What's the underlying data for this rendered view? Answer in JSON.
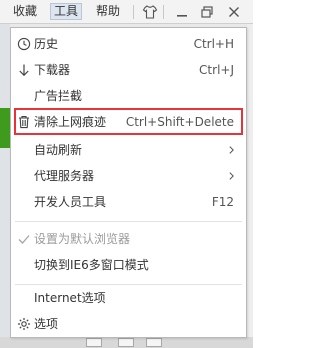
{
  "menubar": {
    "favorites_label": "收藏",
    "tools_label": "工具",
    "help_label": "帮助"
  },
  "menu": {
    "items": [
      {
        "label": "历史",
        "shortcut": "Ctrl+H",
        "icon": "clock-icon"
      },
      {
        "label": "下载器",
        "shortcut": "Ctrl+J",
        "icon": "download-arrow-icon"
      },
      {
        "label": "广告拦截",
        "shortcut": "",
        "icon": ""
      },
      {
        "label": "清除上网痕迹",
        "shortcut": "Ctrl+Shift+Delete",
        "icon": "trash-icon"
      },
      {
        "label": "自动刷新",
        "shortcut": "",
        "icon": "",
        "submenu": true
      },
      {
        "label": "代理服务器",
        "shortcut": "",
        "icon": "",
        "submenu": true
      },
      {
        "label": "开发人员工具",
        "shortcut": "F12",
        "icon": ""
      },
      {
        "label": "设置为默认浏览器",
        "shortcut": "",
        "icon": "check-icon",
        "disabled": true
      },
      {
        "label": "切换到IE6多窗口模式",
        "shortcut": "",
        "icon": ""
      },
      {
        "label": "Internet选项",
        "shortcut": "",
        "icon": ""
      },
      {
        "label": "选项",
        "shortcut": "",
        "icon": "gear-icon"
      }
    ]
  },
  "colors": {
    "highlight_border": "#e8333a",
    "menu_border": "#b9b9b9",
    "disabled_text": "#9a9a9a"
  }
}
